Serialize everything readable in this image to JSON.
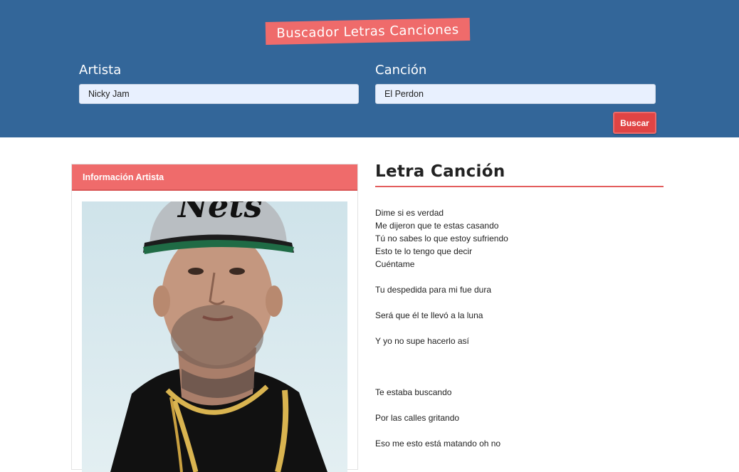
{
  "app": {
    "title": "Buscador Letras Canciones"
  },
  "form": {
    "artist_label": "Artista",
    "artist_value": "Nicky Jam",
    "song_label": "Canción",
    "song_value": "El Perdon",
    "search_button": "Buscar"
  },
  "artist_card": {
    "header": "Información Artista"
  },
  "lyrics": {
    "title": "Letra Canción",
    "lines": [
      "Dime si es verdad",
      "Me dijeron que te estas casando",
      "Tú no sabes lo que estoy sufriendo",
      "Esto te lo tengo que decir",
      "Cuéntame",
      "",
      "Tu despedida para mi fue dura",
      "",
      "Será que él te llevó a la luna",
      "",
      "Y yo no supe hacerlo así",
      "",
      "",
      "",
      "Te estaba buscando",
      "",
      "Por las calles gritando",
      "",
      "Eso me esto está matando oh no"
    ]
  },
  "colors": {
    "header_bg": "#336699",
    "accent": "#ef6b6b",
    "button": "#e04444"
  }
}
